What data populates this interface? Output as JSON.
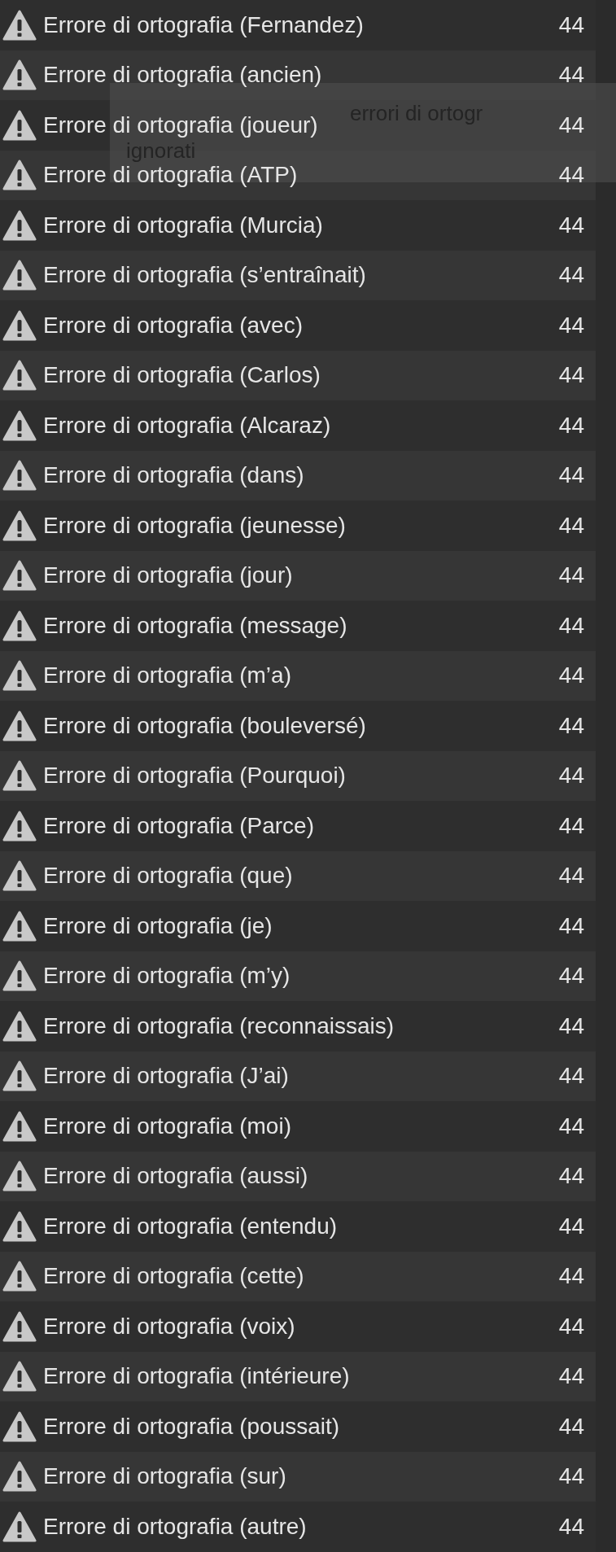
{
  "rows": [
    {
      "message": "Errore di ortografia (Fernandez)",
      "count": "44"
    },
    {
      "message": "Errore di ortografia (ancien)",
      "count": "44"
    },
    {
      "message": "Errore di ortografia (joueur)",
      "count": "44"
    },
    {
      "message": "Errore di ortografia (ATP)",
      "count": "44"
    },
    {
      "message": "Errore di ortografia (Murcia)",
      "count": "44"
    },
    {
      "message": "Errore di ortografia (s’entraînait)",
      "count": "44"
    },
    {
      "message": "Errore di ortografia (avec)",
      "count": "44"
    },
    {
      "message": "Errore di ortografia (Carlos)",
      "count": "44"
    },
    {
      "message": "Errore di ortografia (Alcaraz)",
      "count": "44"
    },
    {
      "message": "Errore di ortografia (dans)",
      "count": "44"
    },
    {
      "message": "Errore di ortografia (jeunesse)",
      "count": "44"
    },
    {
      "message": "Errore di ortografia (jour)",
      "count": "44"
    },
    {
      "message": "Errore di ortografia (message)",
      "count": "44"
    },
    {
      "message": "Errore di ortografia (m’a)",
      "count": "44"
    },
    {
      "message": "Errore di ortografia (bouleversé)",
      "count": "44"
    },
    {
      "message": "Errore di ortografia (Pourquoi)",
      "count": "44"
    },
    {
      "message": "Errore di ortografia (Parce)",
      "count": "44"
    },
    {
      "message": "Errore di ortografia (que)",
      "count": "44"
    },
    {
      "message": "Errore di ortografia (je)",
      "count": "44"
    },
    {
      "message": "Errore di ortografia (m’y)",
      "count": "44"
    },
    {
      "message": "Errore di ortografia (reconnaissais)",
      "count": "44"
    },
    {
      "message": "Errore di ortografia (J’ai)",
      "count": "44"
    },
    {
      "message": "Errore di ortografia (moi)",
      "count": "44"
    },
    {
      "message": "Errore di ortografia (aussi)",
      "count": "44"
    },
    {
      "message": "Errore di ortografia (entendu)",
      "count": "44"
    },
    {
      "message": "Errore di ortografia (cette)",
      "count": "44"
    },
    {
      "message": "Errore di ortografia (voix)",
      "count": "44"
    },
    {
      "message": "Errore di ortografia (intérieure)",
      "count": "44"
    },
    {
      "message": "Errore di ortografia (poussait)",
      "count": "44"
    },
    {
      "message": "Errore di ortografia (sur)",
      "count": "44"
    },
    {
      "message": "Errore di ortografia (autre)",
      "count": "44"
    }
  ],
  "tooltip": {
    "lines": [
      "errori di ortogr",
      "ignorati"
    ]
  }
}
